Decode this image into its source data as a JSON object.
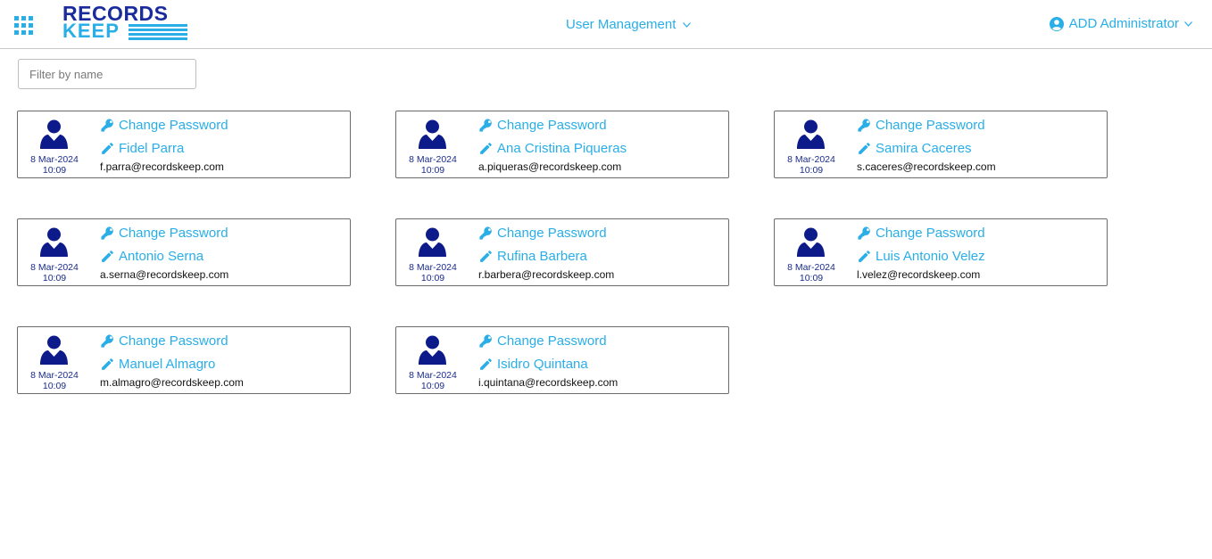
{
  "header": {
    "logo_top": "RECORDS",
    "logo_bottom": "KEEP",
    "nav_menu_label": "User Management",
    "user_menu_label": "ADD Administrator"
  },
  "filter": {
    "placeholder": "Filter by name",
    "value": ""
  },
  "colors": {
    "accent": "#29aee8",
    "brand_dark": "#1a2c9c",
    "avatar": "#0d1a8a"
  },
  "icons": {
    "apps": "apps-grid-icon",
    "key": "key-icon",
    "edit": "pencil-icon",
    "avatar": "user-avatar-icon",
    "account": "account-circle-icon",
    "chevron": "chevron-down-icon"
  },
  "users": [
    {
      "date": "8 Mar-2024",
      "time": "10:09",
      "change_password": "Change Password",
      "name": "Fidel Parra",
      "email": "f.parra@recordskeep.com"
    },
    {
      "date": "8 Mar-2024",
      "time": "10:09",
      "change_password": "Change Password",
      "name": "Ana Cristina Piqueras",
      "email": "a.piqueras@recordskeep.com"
    },
    {
      "date": "8 Mar-2024",
      "time": "10:09",
      "change_password": "Change Password",
      "name": "Samira Caceres",
      "email": "s.caceres@recordskeep.com"
    },
    {
      "date": "8 Mar-2024",
      "time": "10:09",
      "change_password": "Change Password",
      "name": "Antonio Serna",
      "email": "a.serna@recordskeep.com"
    },
    {
      "date": "8 Mar-2024",
      "time": "10:09",
      "change_password": "Change Password",
      "name": "Rufina Barbera",
      "email": "r.barbera@recordskeep.com"
    },
    {
      "date": "8 Mar-2024",
      "time": "10:09",
      "change_password": "Change Password",
      "name": "Luis Antonio Velez",
      "email": "l.velez@recordskeep.com"
    },
    {
      "date": "8 Mar-2024",
      "time": "10:09",
      "change_password": "Change Password",
      "name": "Manuel Almagro",
      "email": "m.almagro@recordskeep.com"
    },
    {
      "date": "8 Mar-2024",
      "time": "10:09",
      "change_password": "Change Password",
      "name": "Isidro Quintana",
      "email": "i.quintana@recordskeep.com"
    }
  ]
}
